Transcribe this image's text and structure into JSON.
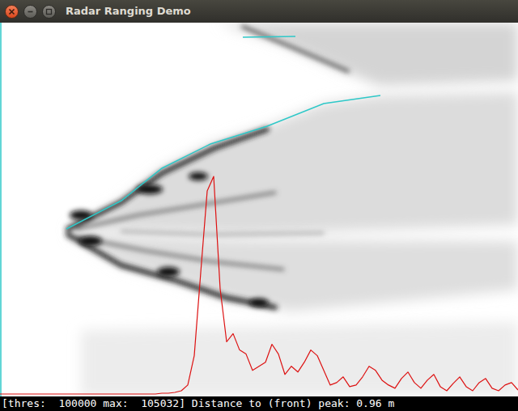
{
  "window": {
    "title": "Radar Ranging Demo"
  },
  "chart": {
    "series": [
      {
        "values": [
          392,
          392,
          392,
          392,
          392,
          392,
          392,
          392,
          392,
          392,
          392,
          392,
          392,
          392,
          392,
          392,
          392,
          392,
          392,
          392,
          392,
          392,
          392,
          392,
          392,
          784,
          784,
          1176,
          1960,
          4704,
          18816,
          58800,
          98000,
          105032,
          50960,
          25480,
          29400,
          21560,
          19600,
          11760,
          13720,
          15680,
          24304,
          19600,
          9800,
          13720,
          10976,
          15680,
          21560,
          18816,
          11760,
          4704,
          5880,
          8624,
          3920,
          4704,
          8624,
          13720,
          11760,
          7056,
          4704,
          3136,
          7840,
          10976,
          5880,
          3136,
          7056,
          9800,
          3920,
          1960,
          5488,
          8624,
          3920,
          1960,
          5880,
          7840,
          3136,
          1960,
          4704,
          5880,
          2352
        ]
      }
    ]
  },
  "status_bar": {
    "text": "[thres:  100000 max:  105032] Distance to (front) peak: 0.96 m"
  }
}
